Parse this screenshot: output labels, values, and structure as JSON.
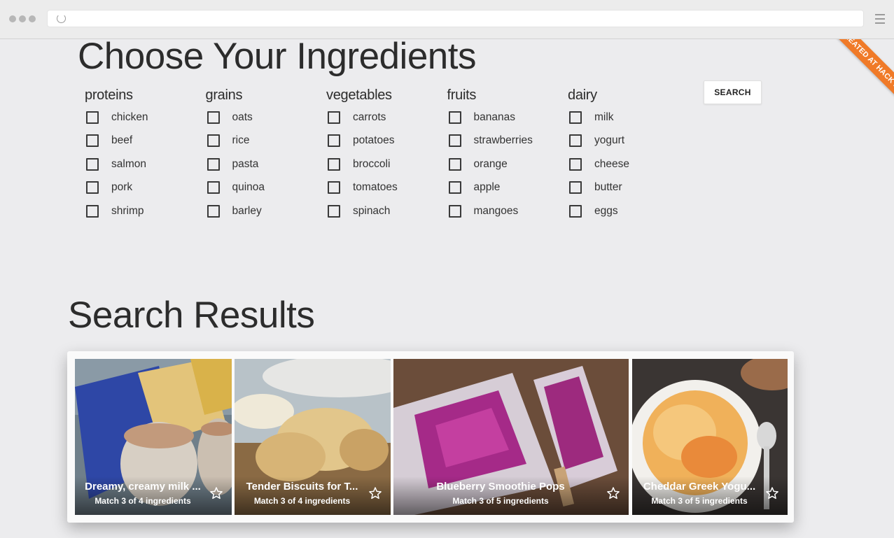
{
  "browser": {
    "url": ""
  },
  "ribbon": {
    "text": "CREATED AT HACK REACTOR"
  },
  "ingredients": {
    "title": "Choose Your Ingredients",
    "search_label": "SEARCH",
    "groups": [
      {
        "name": "proteins",
        "items": [
          "chicken",
          "beef",
          "salmon",
          "pork",
          "shrimp"
        ]
      },
      {
        "name": "grains",
        "items": [
          "oats",
          "rice",
          "pasta",
          "quinoa",
          "barley"
        ]
      },
      {
        "name": "vegetables",
        "items": [
          "carrots",
          "potatoes",
          "broccoli",
          "tomatoes",
          "spinach"
        ]
      },
      {
        "name": "fruits",
        "items": [
          "bananas",
          "strawberries",
          "orange",
          "apple",
          "mangoes"
        ]
      },
      {
        "name": "dairy",
        "items": [
          "milk",
          "yogurt",
          "cheese",
          "butter",
          "eggs"
        ]
      }
    ]
  },
  "results": {
    "title": "Search Results",
    "cards": [
      {
        "title": "Dreamy, creamy milk ...",
        "match": "Match 3 of 4 ingredients"
      },
      {
        "title": "Tender Biscuits for T...",
        "match": "Match 3 of 4 ingredients"
      },
      {
        "title": "Blueberry Smoothie Pops",
        "match": "Match 3 of 5 ingredients"
      },
      {
        "title": "Cheddar Greek Yogu...",
        "match": "Match 3 of 5 ingredients"
      }
    ]
  },
  "colors": {
    "background": "#ececee",
    "ribbon": "#f07a28",
    "text": "#2c2c2c"
  },
  "icons": {
    "favorite": "star-outline-icon",
    "menu": "hamburger-icon",
    "reload": "reload-icon"
  }
}
